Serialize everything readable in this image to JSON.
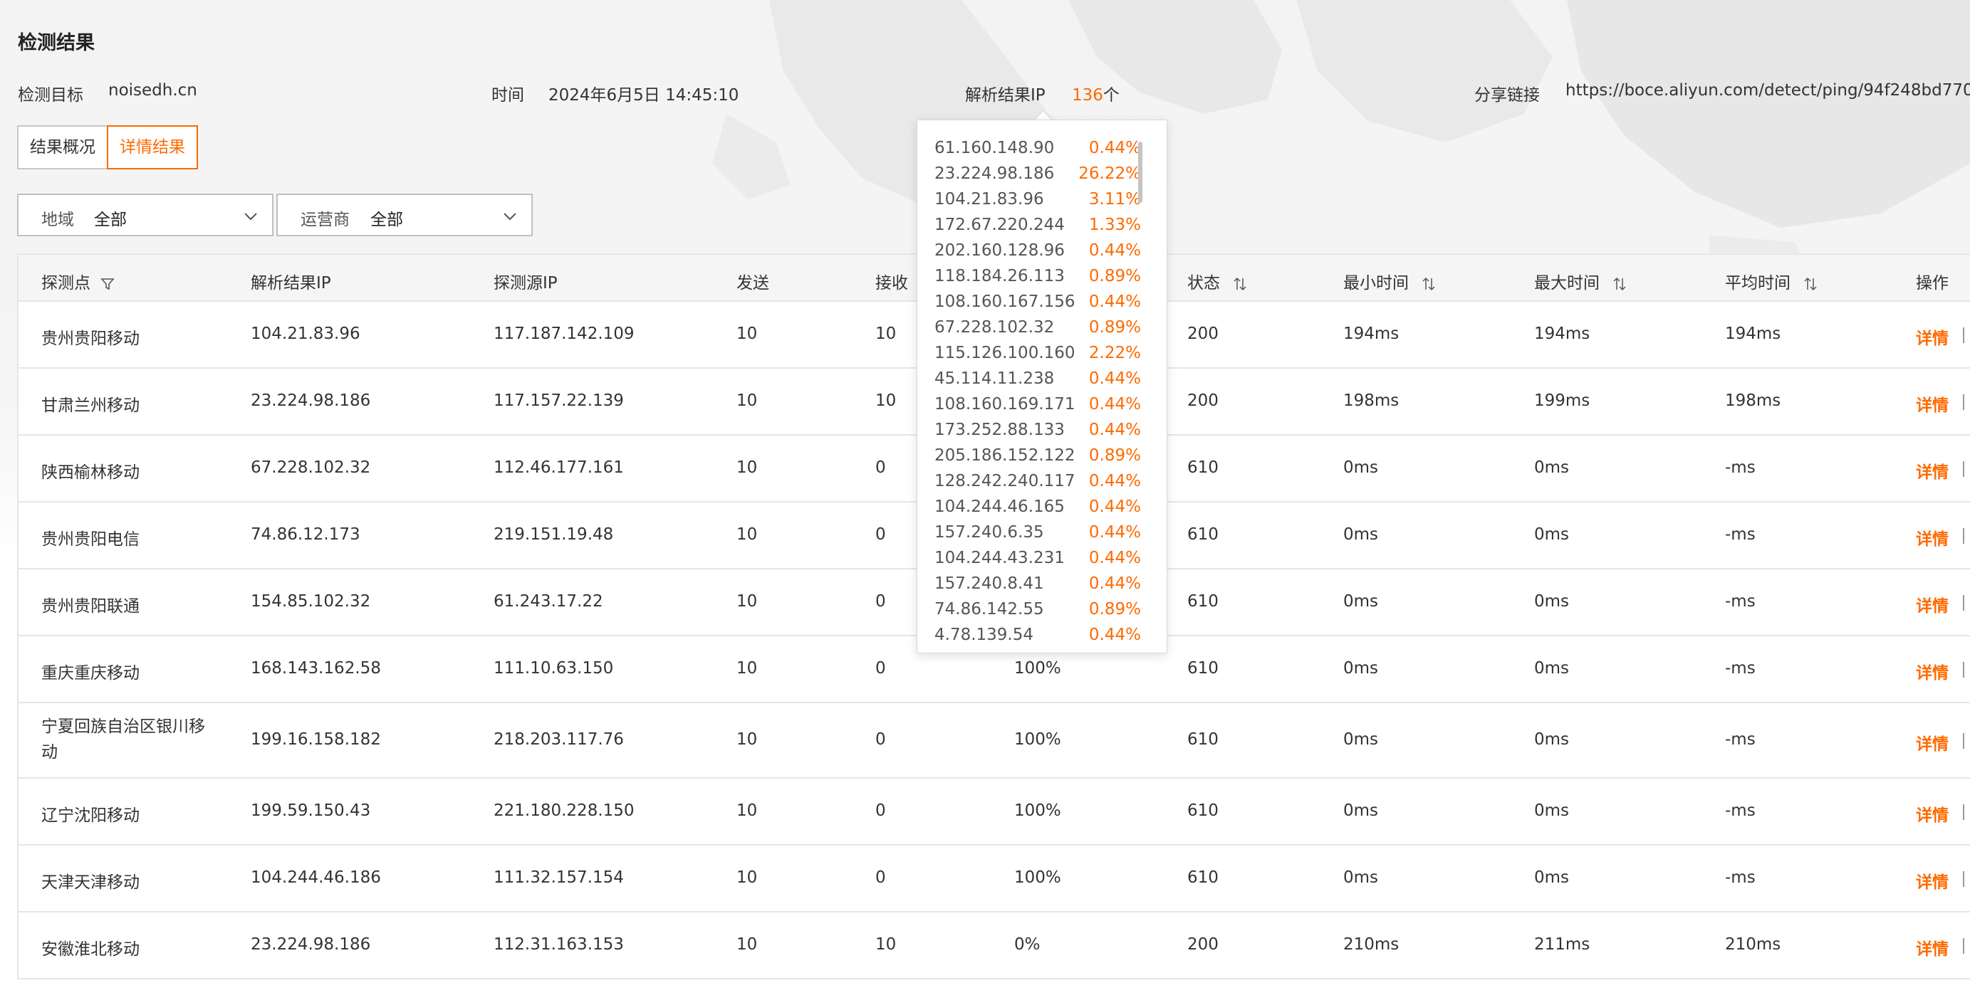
{
  "title": "检测结果",
  "info": {
    "target_label": "检测目标",
    "target_value": "noisedh.cn",
    "time_label": "时间",
    "time_value": "2024年6月5日 14:45:10",
    "ip_label": "解析结果IP",
    "ip_count": "136",
    "ip_unit": "个",
    "share_label": "分享链接",
    "share_value": "https://boce.aliyun.com/detect/ping/94f248bd770"
  },
  "tabs": [
    {
      "label": "结果概况",
      "active": false
    },
    {
      "label": "详情结果",
      "active": true
    }
  ],
  "filters": {
    "region_label": "地域",
    "region_value": "全部",
    "isp_label": "运营商",
    "isp_value": "全部"
  },
  "columns": {
    "probe": "探测点",
    "resolved_ip": "解析结果IP",
    "source_ip": "探测源IP",
    "sent": "发送",
    "received": "接收",
    "status": "状态",
    "min_time": "最小时间",
    "max_time": "最大时间",
    "avg_time": "平均时间",
    "action": "操作"
  },
  "rows": [
    {
      "probe": "贵州贵阳移动",
      "resolved_ip": "104.21.83.96",
      "source_ip": "117.187.142.109",
      "sent": "10",
      "received": "10",
      "loss": "",
      "status": "200",
      "min": "194ms",
      "max": "194ms",
      "avg": "194ms",
      "action": "详情"
    },
    {
      "probe": "甘肃兰州移动",
      "resolved_ip": "23.224.98.186",
      "source_ip": "117.157.22.139",
      "sent": "10",
      "received": "10",
      "loss": "",
      "status": "200",
      "min": "198ms",
      "max": "199ms",
      "avg": "198ms",
      "action": "详情"
    },
    {
      "probe": "陕西榆林移动",
      "resolved_ip": "67.228.102.32",
      "source_ip": "112.46.177.161",
      "sent": "10",
      "received": "0",
      "loss": "",
      "status": "610",
      "min": "0ms",
      "max": "0ms",
      "avg": "-ms",
      "action": "详情"
    },
    {
      "probe": "贵州贵阳电信",
      "resolved_ip": "74.86.12.173",
      "source_ip": "219.151.19.48",
      "sent": "10",
      "received": "0",
      "loss": "",
      "status": "610",
      "min": "0ms",
      "max": "0ms",
      "avg": "-ms",
      "action": "详情"
    },
    {
      "probe": "贵州贵阳联通",
      "resolved_ip": "154.85.102.32",
      "source_ip": "61.243.17.22",
      "sent": "10",
      "received": "0",
      "loss": "",
      "status": "610",
      "min": "0ms",
      "max": "0ms",
      "avg": "-ms",
      "action": "详情"
    },
    {
      "probe": "重庆重庆移动",
      "resolved_ip": "168.143.162.58",
      "source_ip": "111.10.63.150",
      "sent": "10",
      "received": "0",
      "loss": "100%",
      "status": "610",
      "min": "0ms",
      "max": "0ms",
      "avg": "-ms",
      "action": "详情"
    },
    {
      "probe": "宁夏回族自治区银川移动",
      "resolved_ip": "199.16.158.182",
      "source_ip": "218.203.117.76",
      "sent": "10",
      "received": "0",
      "loss": "100%",
      "status": "610",
      "min": "0ms",
      "max": "0ms",
      "avg": "-ms",
      "action": "详情"
    },
    {
      "probe": "辽宁沈阳移动",
      "resolved_ip": "199.59.150.43",
      "source_ip": "221.180.228.150",
      "sent": "10",
      "received": "0",
      "loss": "100%",
      "status": "610",
      "min": "0ms",
      "max": "0ms",
      "avg": "-ms",
      "action": "详情"
    },
    {
      "probe": "天津天津移动",
      "resolved_ip": "104.244.46.186",
      "source_ip": "111.32.157.154",
      "sent": "10",
      "received": "0",
      "loss": "100%",
      "status": "610",
      "min": "0ms",
      "max": "0ms",
      "avg": "-ms",
      "action": "详情"
    },
    {
      "probe": "安徽淮北移动",
      "resolved_ip": "23.224.98.186",
      "source_ip": "112.31.163.153",
      "sent": "10",
      "received": "10",
      "loss": "0%",
      "status": "200",
      "min": "210ms",
      "max": "211ms",
      "avg": "210ms",
      "action": "详情"
    }
  ],
  "ip_popover": [
    {
      "ip": "61.160.148.90",
      "pct": "0.44%"
    },
    {
      "ip": "23.224.98.186",
      "pct": "26.22%"
    },
    {
      "ip": "104.21.83.96",
      "pct": "3.11%"
    },
    {
      "ip": "172.67.220.244",
      "pct": "1.33%"
    },
    {
      "ip": "202.160.128.96",
      "pct": "0.44%"
    },
    {
      "ip": "118.184.26.113",
      "pct": "0.89%"
    },
    {
      "ip": "108.160.167.156",
      "pct": "0.44%"
    },
    {
      "ip": "67.228.102.32",
      "pct": "0.89%"
    },
    {
      "ip": "115.126.100.160",
      "pct": "2.22%"
    },
    {
      "ip": "45.114.11.238",
      "pct": "0.44%"
    },
    {
      "ip": "108.160.169.171",
      "pct": "0.44%"
    },
    {
      "ip": "173.252.88.133",
      "pct": "0.44%"
    },
    {
      "ip": "205.186.152.122",
      "pct": "0.89%"
    },
    {
      "ip": "128.242.240.117",
      "pct": "0.44%"
    },
    {
      "ip": "104.244.46.165",
      "pct": "0.44%"
    },
    {
      "ip": "157.240.6.35",
      "pct": "0.44%"
    },
    {
      "ip": "104.244.43.231",
      "pct": "0.44%"
    },
    {
      "ip": "157.240.8.41",
      "pct": "0.44%"
    },
    {
      "ip": "74.86.142.55",
      "pct": "0.89%"
    },
    {
      "ip": "4.78.139.54",
      "pct": "0.44%"
    }
  ],
  "colors": {
    "accent": "#ff6a00",
    "border": "#e6e6e6",
    "header_bg": "#f5f5f5"
  }
}
